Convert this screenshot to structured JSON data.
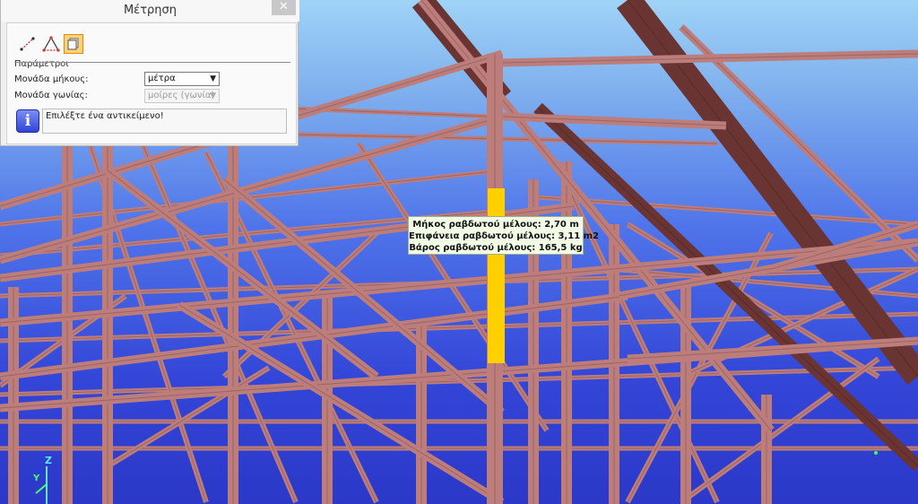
{
  "panel": {
    "title": "Μέτρηση",
    "close_label": "✕",
    "tools": [
      {
        "name": "distance-tool",
        "icon": "measure-distance-icon"
      },
      {
        "name": "angle-tool",
        "icon": "measure-angle-icon"
      },
      {
        "name": "object-tool",
        "icon": "measure-object-icon",
        "active": true
      }
    ],
    "group_label": "Παράμετροι",
    "length_unit_label": "Μονάδα μήκους:",
    "length_unit_value": "μέτρα",
    "angle_unit_label": "Μονάδα γωνίας:",
    "angle_unit_value": "μοίρες (γωνία)",
    "info_icon": "i",
    "info_text": "Επιλέξτε ένα αντικείμενο!"
  },
  "tooltip": {
    "length": "Μήκος ραβδωτού μέλους: 2,70 m",
    "area": "Επιφάνεια ραβδωτού μέλους: 3,11 m2",
    "weight": "Βάρος ραβδωτού μέλους: 165,5 kg"
  },
  "axes": {
    "z": "Z",
    "y": "Y"
  },
  "colors": {
    "member": "#bd7d7b",
    "member_dark": "#6a3433",
    "highlight": "#ffd000",
    "sky_top": "#9fd3f6",
    "sky_bottom": "#2b38c8"
  }
}
